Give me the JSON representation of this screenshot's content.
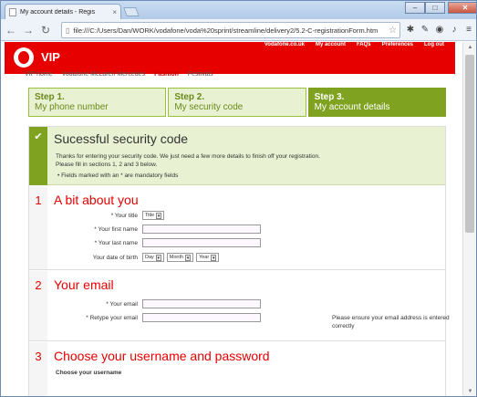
{
  "browser": {
    "tab_title": "My account details - Regis",
    "url": "file:///C:/Users/Dan/WORK/vodafone/voda%20sprint/streamline/delivery2/5.2-C-registrationForm.htm",
    "window_controls": {
      "minimize": "–",
      "maximize": "□",
      "close": "✕"
    }
  },
  "header": {
    "brand": "VIP",
    "top_links": [
      "Vodafone.co.uk",
      "My account",
      "FAQs",
      "Preferences",
      "Log out"
    ],
    "sub_nav": [
      {
        "label": "VIP home",
        "active": false
      },
      {
        "label": "Vodafone McLaren Mercedes",
        "active": false
      },
      {
        "label": "Fashion",
        "active": true
      },
      {
        "label": "Festivals",
        "active": false
      }
    ]
  },
  "steps": [
    {
      "num": "Step 1.",
      "label": "My phone number",
      "active": false
    },
    {
      "num": "Step 2.",
      "label": "My security code",
      "active": false
    },
    {
      "num": "Step 3.",
      "label": "My account details",
      "active": true
    }
  ],
  "success": {
    "check": "✔",
    "title": "Sucessful security code",
    "line1": "Thanks for entering your security code. We just need a few more details to finish off your registration.",
    "line2": "Please fill in sections 1, 2 and 3 below.",
    "bullet": "•  Fields marked with an * are mandatory fields"
  },
  "section1": {
    "num": "1",
    "title": "A bit about you",
    "title_label": "* Your title",
    "title_select": "Title",
    "first_name_label": "* Your first name",
    "first_name_value": "",
    "last_name_label": "* Your last name",
    "last_name_value": "",
    "dob_label": "Your date of birth",
    "dob_day": "Day",
    "dob_month": "Month",
    "dob_year": "Year"
  },
  "section2": {
    "num": "2",
    "title": "Your email",
    "email_label": "* Your email",
    "email_value": "",
    "retype_label": "* Retype your email",
    "retype_value": "",
    "note": "Please ensure your email address is entered correctly"
  },
  "section3": {
    "num": "3",
    "title": "Choose your username and password",
    "username_heading": "Choose your username"
  },
  "colors": {
    "brand": "#e60000",
    "step_active": "#7fa321",
    "step_inactive": "#e8f1d2"
  }
}
